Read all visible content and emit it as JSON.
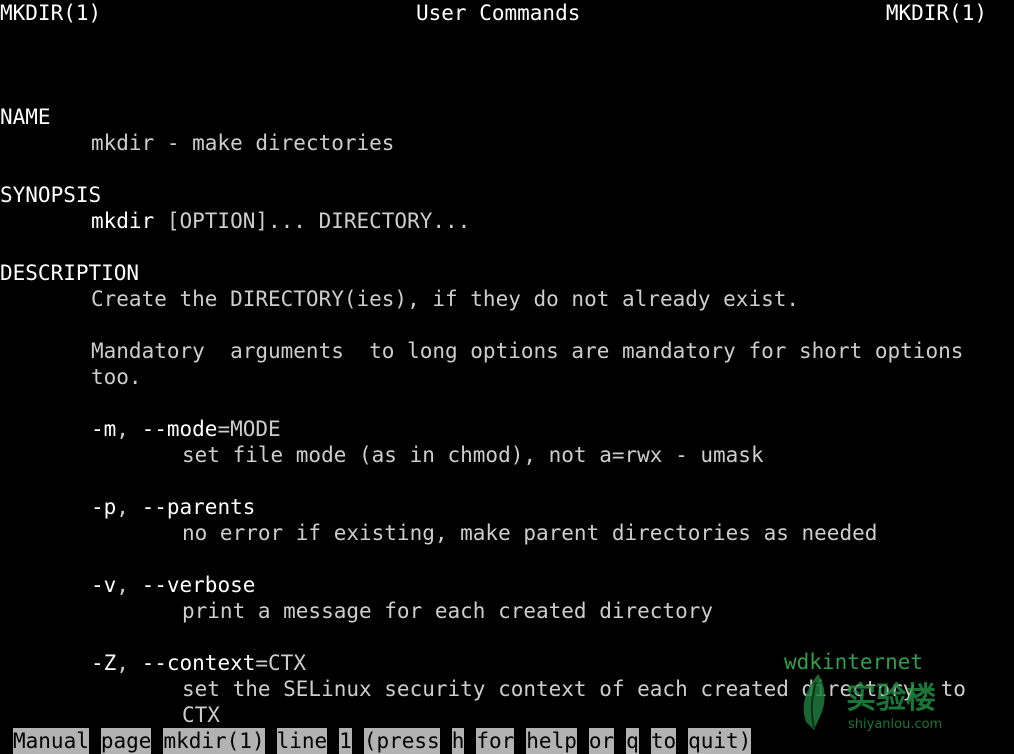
{
  "header": {
    "left": "MKDIR(1)",
    "center": "User Commands",
    "right": "MKDIR(1)"
  },
  "sections": {
    "name_heading": "NAME",
    "name_text": "mkdir - make directories",
    "synopsis_heading": "SYNOPSIS",
    "synopsis_command": "mkdir",
    "synopsis_args": " [OPTION]... DIRECTORY...",
    "description_heading": "DESCRIPTION",
    "desc_line1": "Create the DIRECTORY(ies), if they do not already exist.",
    "desc_line2": "Mandatory  arguments  to long options are mandatory for short options",
    "desc_line3": "too."
  },
  "options": [
    {
      "short": "-m",
      "sep": ", ",
      "long": "--mode",
      "arg": "=MODE",
      "desc": [
        "set file mode (as in chmod), not a=rwx - umask"
      ]
    },
    {
      "short": "-p",
      "sep": ", ",
      "long": "--parents",
      "arg": "",
      "desc": [
        "no error if existing, make parent directories as needed"
      ]
    },
    {
      "short": "-v",
      "sep": ", ",
      "long": "--verbose",
      "arg": "",
      "desc": [
        "print a message for each created directory"
      ]
    },
    {
      "short": "-Z",
      "sep": ", ",
      "long": "--context",
      "arg": "=CTX",
      "desc": [
        "set the SELinux security context of each created directory  to",
        "CTX"
      ]
    }
  ],
  "statusbar": {
    "words": [
      "Manual",
      "page",
      "mkdir(1)",
      "line",
      "1",
      "(press",
      "h",
      "for",
      "help",
      "or",
      "q",
      "to",
      "quit)"
    ]
  },
  "watermark": {
    "user": "wdkinternet",
    "logo_text": "实验楼",
    "logo_sub": "shiyanlou.com",
    "color": "#2e9e4a"
  },
  "colors": {
    "background": "#000000",
    "text": "#cdcdcd",
    "bold": "#ffffff",
    "status_bg": "#b2b2b2"
  }
}
